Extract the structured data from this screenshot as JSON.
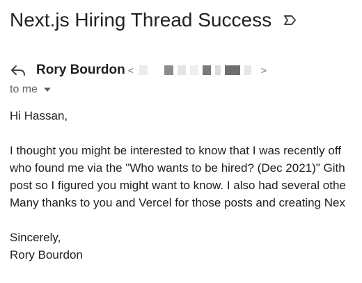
{
  "email": {
    "subject": "Next.js Hiring Thread Success",
    "label_icon": "label-important-icon",
    "sender": {
      "name": "Rory Bourdon",
      "addr_open": "<",
      "addr_close": ">",
      "address_redacted": true
    },
    "recipient": {
      "text": "to me"
    },
    "body": {
      "greeting": "Hi Hassan,",
      "paragraph_lines": [
        "I thought you might be interested to know that I was recently off",
        "who found me via the \"Who wants to be hired? (Dec 2021)\" Gith",
        "post so I figured you might want to know. I also had several othe",
        "Many thanks to you and Vercel for those posts and creating Nex"
      ],
      "closing": "Sincerely,",
      "signature": "Rory Bourdon"
    }
  },
  "icons": {
    "reply": "reply-icon",
    "dropdown": "chevron-down-icon",
    "label": "label-important-icon"
  },
  "colors": {
    "text_primary": "#202124",
    "text_secondary": "#5f6368",
    "redaction_light": "#e8e8e8",
    "redaction_mid": "#9a9a9a",
    "redaction_dark": "#6b6b6b"
  }
}
